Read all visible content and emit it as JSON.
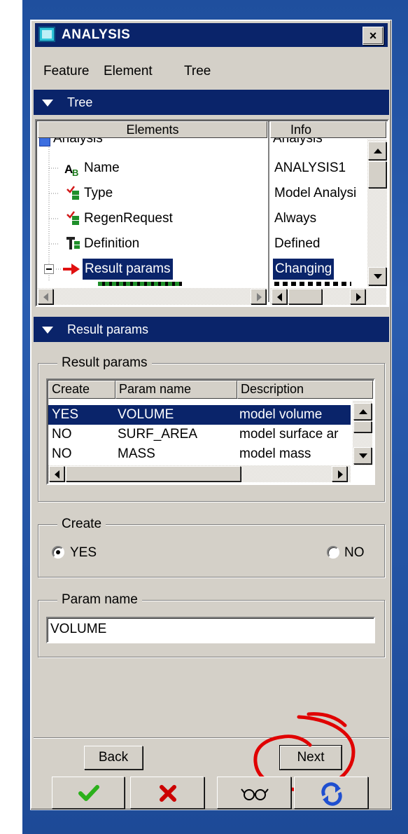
{
  "window": {
    "title": "ANALYSIS",
    "close_label": "×"
  },
  "menu": [
    "Feature",
    "Element",
    "Tree"
  ],
  "tree_section": {
    "label": "Tree",
    "headers": {
      "elements": "Elements",
      "info": "Info"
    },
    "rows": [
      {
        "element": "Analysis",
        "info": "Analysis",
        "icon": "analysis-icon"
      },
      {
        "element": "Name",
        "info": "ANALYSIS1",
        "icon": "name-ab-icon"
      },
      {
        "element": "Type",
        "info": "Model Analysi",
        "icon": "type-icon"
      },
      {
        "element": "RegenRequest",
        "info": "Always",
        "icon": "regen-icon"
      },
      {
        "element": "Definition",
        "info": "Defined",
        "icon": "definition-icon"
      },
      {
        "element": "Result params",
        "info": "Changing",
        "icon": "red-arrow-icon"
      }
    ]
  },
  "result_section": {
    "label": "Result params",
    "group_title": "Result params",
    "headers": [
      "Create",
      "Param name",
      "Description"
    ],
    "rows": [
      [
        "YES",
        "VOLUME",
        "model volume"
      ],
      [
        "NO",
        "SURF_AREA",
        "model surface ar"
      ],
      [
        "NO",
        "MASS",
        "model mass"
      ]
    ]
  },
  "create_group": {
    "title": "Create",
    "options": [
      "YES",
      "NO"
    ],
    "selected": "YES"
  },
  "param_group": {
    "title": "Param name",
    "value": "VOLUME"
  },
  "buttons": {
    "back": "Back",
    "next": "Next",
    "ok_icon": "checkmark-icon",
    "cancel_icon": "cross-icon",
    "preview_icon": "glasses-icon",
    "repaint_icon": "refresh-icon"
  },
  "colors": {
    "title_bar": "#0a246a",
    "dialog": "#d4d0c8",
    "annotation": "#e00000",
    "ok_green": "#2bb01b",
    "cancel_red": "#cc0000"
  }
}
